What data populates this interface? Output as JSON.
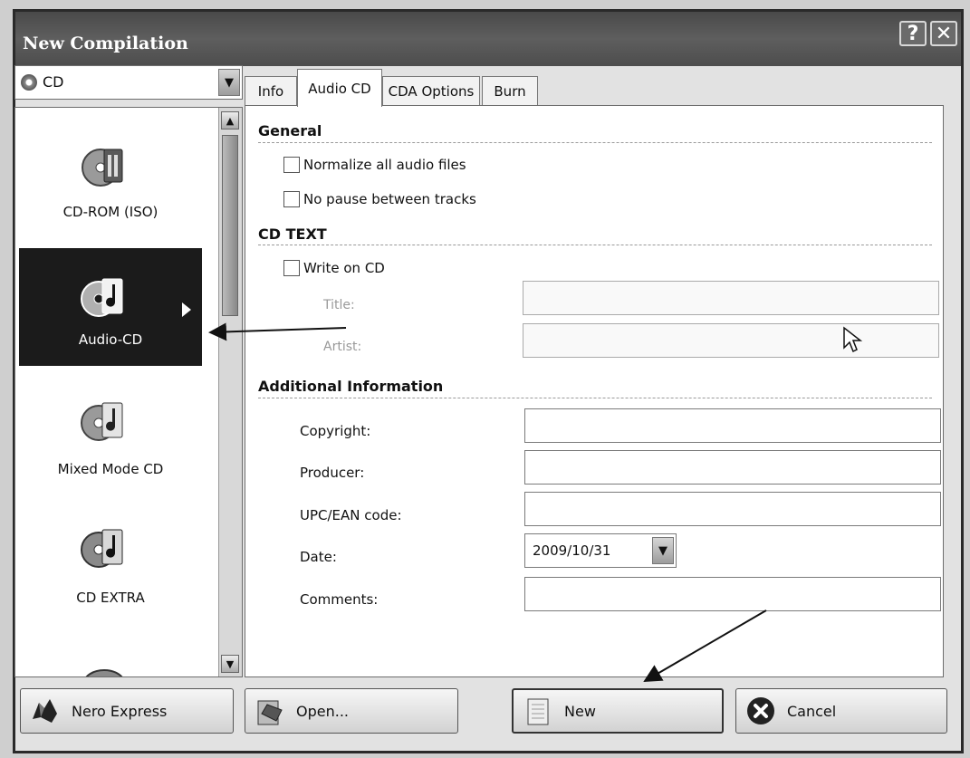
{
  "window": {
    "title": "New Compilation",
    "help_glyph": "?",
    "close_glyph": "✕"
  },
  "media_combo": {
    "value": "CD",
    "icon": "cd-disc-icon",
    "arrow_glyph": "▼"
  },
  "compilation_types": [
    {
      "label": "CD-ROM (ISO)",
      "icon": "cd-rom-icon",
      "selected": false
    },
    {
      "label": "Audio-CD",
      "icon": "audio-cd-icon",
      "selected": true
    },
    {
      "label": "Mixed Mode CD",
      "icon": "mixed-mode-cd-icon",
      "selected": false
    },
    {
      "label": "CD EXTRA",
      "icon": "cd-extra-icon",
      "selected": false
    }
  ],
  "scroll": {
    "up_glyph": "▲",
    "down_glyph": "▼"
  },
  "tabs": [
    {
      "label": "Info",
      "active": false
    },
    {
      "label": "Audio CD",
      "active": true
    },
    {
      "label": "CDA Options",
      "active": false
    },
    {
      "label": "Burn",
      "active": false
    }
  ],
  "general": {
    "heading": "General",
    "normalize_label": "Normalize all audio files",
    "normalize_checked": false,
    "no_pause_label": "No pause between tracks",
    "no_pause_checked": false
  },
  "cd_text": {
    "heading": "CD TEXT",
    "write_label": "Write on CD",
    "write_checked": false,
    "title_label": "Title:",
    "title_value": "",
    "artist_label": "Artist:",
    "artist_value": ""
  },
  "additional": {
    "heading": "Additional Information",
    "copyright_label": "Copyright:",
    "copyright_value": "",
    "producer_label": "Producer:",
    "producer_value": "",
    "upc_label": "UPC/EAN code:",
    "upc_value": "",
    "date_label": "Date:",
    "date_value": "2009/10/31",
    "comments_label": "Comments:",
    "comments_value": ""
  },
  "buttons": {
    "nero_express": "Nero Express",
    "open": "Open...",
    "new": "New",
    "cancel": "Cancel"
  },
  "colors": {
    "selection": "#1b1b1b",
    "titlebar": "#4f4f4f"
  }
}
